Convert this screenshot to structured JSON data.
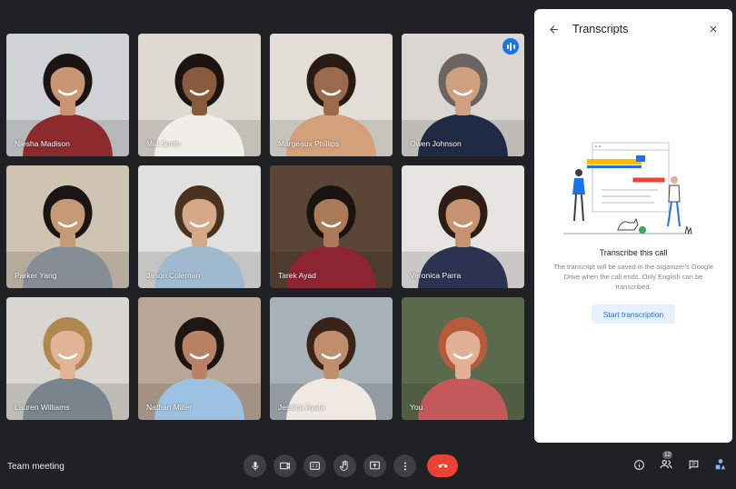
{
  "meeting": {
    "name": "Team meeting"
  },
  "participants": [
    {
      "name": "Niesha Madison",
      "bg": "#cfd3d4",
      "skin": "#c99673",
      "hair": "#1b1413",
      "shirt": "#8c2a2e",
      "speaking": false
    },
    {
      "name": "Mia Smith",
      "bg": "#dedad2",
      "skin": "#8a5a3c",
      "hair": "#1c1410",
      "shirt": "#efeee8",
      "speaking": false
    },
    {
      "name": "Margeaux Phillips",
      "bg": "#e2ddd7",
      "skin": "#9a6a4c",
      "hair": "#2a1a14",
      "shirt": "#d2a079",
      "speaking": false
    },
    {
      "name": "Owen Johnson",
      "bg": "#dad7d2",
      "skin": "#cf9f80",
      "hair": "#6b6460",
      "shirt": "#1f2a44",
      "speaking": true
    },
    {
      "name": "Parker Yang",
      "bg": "#cfc3b1",
      "skin": "#c69a74",
      "hair": "#1a1615",
      "shirt": "#868d97",
      "speaking": false
    },
    {
      "name": "Jason Coleman",
      "bg": "#e0e1df",
      "skin": "#d5a888",
      "hair": "#4a3220",
      "shirt": "#9fb9cf",
      "speaking": false
    },
    {
      "name": "Tarek Ayad",
      "bg": "#5b4537",
      "skin": "#a9795a",
      "hair": "#1a1410",
      "shirt": "#8c2432",
      "speaking": false
    },
    {
      "name": "Veronica Parra",
      "bg": "#e5e4e1",
      "skin": "#c6926f",
      "hair": "#2e1d14",
      "shirt": "#2b3350",
      "speaking": false
    },
    {
      "name": "Lauren Williams",
      "bg": "#d8d6d1",
      "skin": "#e1b496",
      "hair": "#b08850",
      "shirt": "#7a848c",
      "speaking": false
    },
    {
      "name": "Nathan Miller",
      "bg": "#b8a796",
      "skin": "#b98264",
      "hair": "#1d1713",
      "shirt": "#9dc1e1",
      "speaking": false
    },
    {
      "name": "Jessica Ayala",
      "bg": "#a7b1b8",
      "skin": "#c08e6d",
      "hair": "#3a2418",
      "shirt": "#f0e9e1",
      "speaking": false
    },
    {
      "name": "You",
      "bg": "#5a6a4d",
      "skin": "#e2b195",
      "hair": "#b55a3a",
      "shirt": "#c4595b",
      "speaking": false
    }
  ],
  "transcripts_panel": {
    "title": "Transcripts",
    "call_title": "Transcribe this call",
    "description": "The transcript will be saved in the organizer's Google Drive when the call ends. Only English can be transcribed.",
    "start_button": "Start transcription"
  },
  "controls": {
    "icons": [
      "microphone-icon",
      "camera-icon",
      "captions-icon",
      "raise-hand-icon",
      "present-screen-icon",
      "more-options-icon",
      "end-call-icon"
    ],
    "end_call_color": "#ea4335"
  },
  "right_icons": {
    "icons": [
      "info-icon",
      "people-icon",
      "chat-icon",
      "activities-icon"
    ],
    "people_count": "12"
  },
  "colors": {
    "accent": "#1a73e8",
    "background": "#202124",
    "control_bg": "#3c4043"
  }
}
